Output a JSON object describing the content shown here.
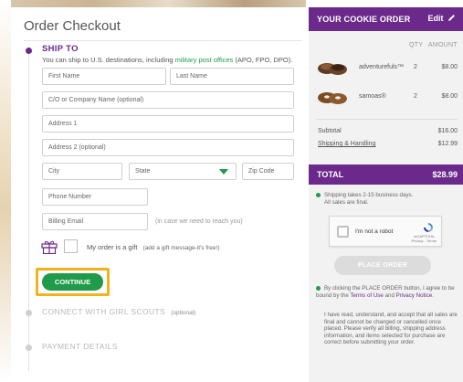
{
  "checkout": {
    "title": "Order Checkout",
    "ship_to": {
      "heading": "SHIP TO",
      "sub_prefix": "You can ship to U.S. destinations, including ",
      "sub_link": "military post offices",
      "sub_suffix": " (APO, FPO, DPO)."
    },
    "fields": {
      "first_name": "First Name",
      "last_name": "Last Name",
      "company": "C/O or Company Name (optional)",
      "address1": "Address 1",
      "address2": "Address 2 (optional)",
      "city": "City",
      "state": "State",
      "zip": "Zip Code",
      "phone": "Phone Number",
      "email": "Billing Email",
      "email_hint": "(in case we need to reach you)"
    },
    "gift": {
      "label": "My order is a gift",
      "hint": "(add a gift message-it's free!)"
    },
    "continue_label": "CONTINUE",
    "steps": {
      "connect": "CONNECT WITH GIRL SCOUTS",
      "connect_optional": "(optional)",
      "payment": "PAYMENT DETAILS"
    }
  },
  "order": {
    "title": "YOUR COOKIE ORDER",
    "edit_label": "Edit",
    "qty_header": "QTY",
    "amount_header": "AMOUNT",
    "items": [
      {
        "name": "adventurefuls™",
        "qty": "2",
        "amount": "$8.00"
      },
      {
        "name": "samoas®",
        "qty": "2",
        "amount": "$8.00"
      }
    ],
    "subtotal_label": "Subtotal",
    "subtotal_value": "$16.00",
    "shipping_label": "Shipping & Handling",
    "shipping_value": "$12.99",
    "total_label": "TOTAL",
    "total_value": "$28.99",
    "shipping_note_1": "Shipping takes 2-15 business days.",
    "shipping_note_2": "All sales are final.",
    "captcha_label": "I'm not a robot",
    "captcha_brand_1": "reCAPTCHA",
    "captcha_brand_2": "Privacy - Terms",
    "place_order_label": "PLACE ORDER",
    "agree_prefix": "By clicking the PLACE ORDER button, I agree to be bound by the ",
    "agree_terms": "Terms of Use",
    "agree_mid": " and ",
    "agree_privacy": "Privacy Notice",
    "agree_suffix": ".",
    "final_note": "I have read, understand, and accept that all sales are final and cannot be changed or cancelled once placed. Please verify all billing, shipping address information, and items selected for purchase are correct before submitting your order."
  },
  "colors": {
    "brand_purple": "#6b2a8b",
    "accent_green": "#1f9b4a",
    "focus_orange": "#f0b31b"
  },
  "icons": [
    "edit-pencil-icon",
    "gift-icon",
    "state-dropdown-arrow-icon",
    "recaptcha-logo-icon"
  ]
}
